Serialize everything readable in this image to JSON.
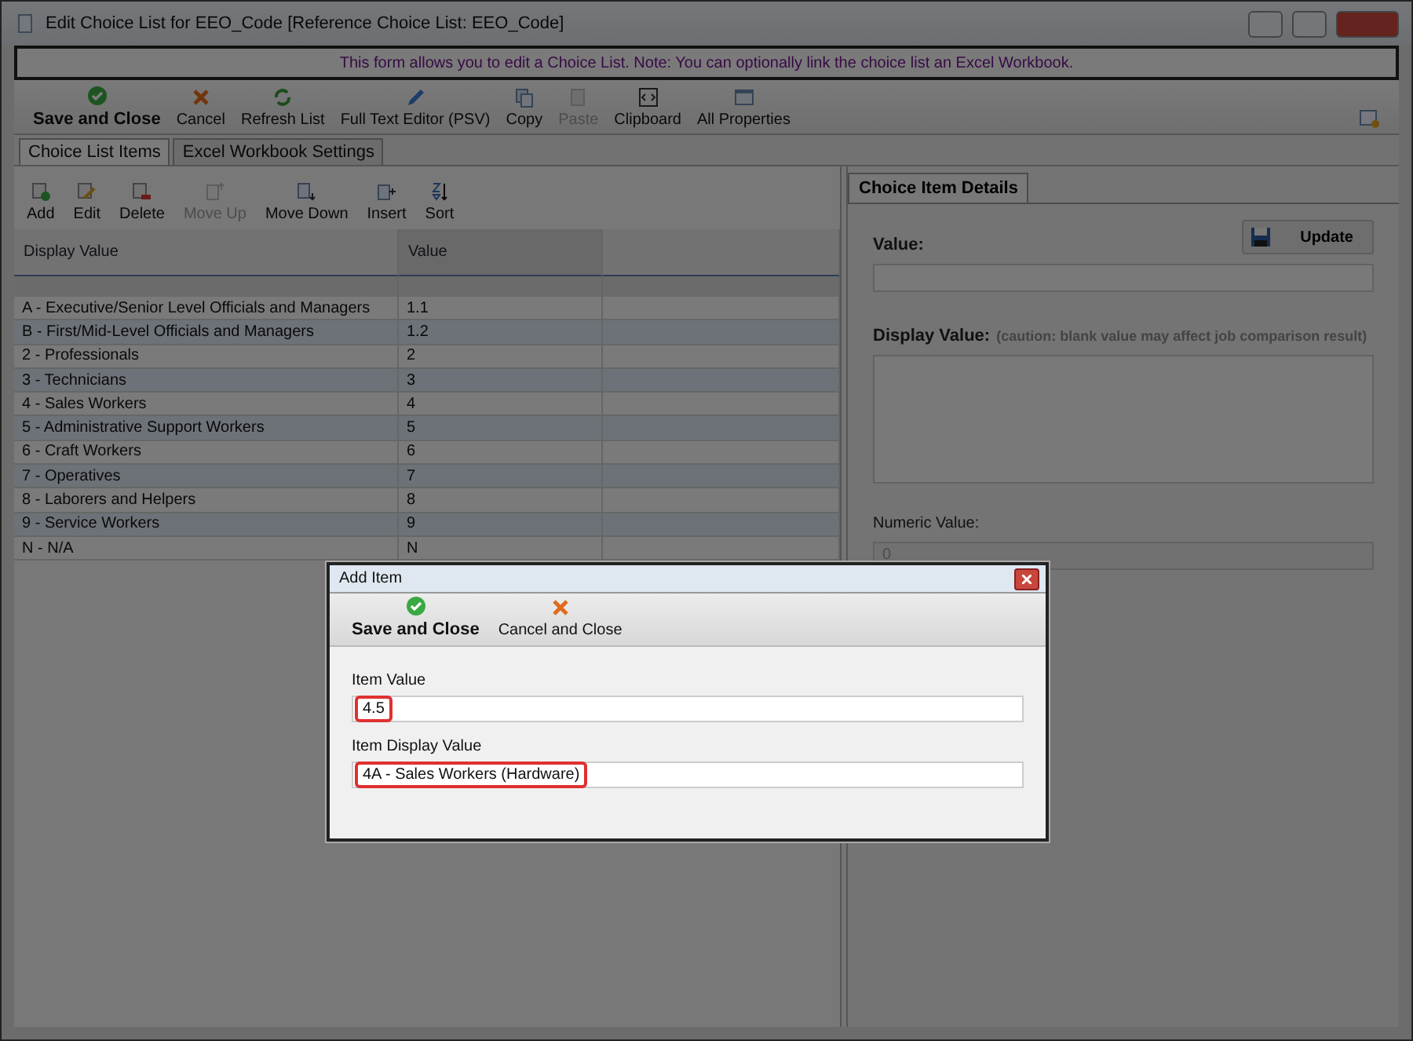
{
  "window": {
    "title": "Edit Choice List for EEO_Code [Reference Choice List: EEO_Code]"
  },
  "banner": "This form allows you to edit a Choice List.  Note: You can optionally link the choice list an Excel Workbook.",
  "toolbar": [
    {
      "label": "Save and Close",
      "primary": true,
      "disabled": false
    },
    {
      "label": "Cancel",
      "primary": false,
      "disabled": false
    },
    {
      "label": "Refresh List",
      "primary": false,
      "disabled": false
    },
    {
      "label": "Full Text Editor (PSV)",
      "primary": false,
      "disabled": false
    },
    {
      "label": "Copy",
      "primary": false,
      "disabled": false
    },
    {
      "label": "Paste",
      "primary": false,
      "disabled": true
    },
    {
      "label": "Clipboard",
      "primary": false,
      "disabled": false
    },
    {
      "label": "All Properties",
      "primary": false,
      "disabled": false
    }
  ],
  "tabs": [
    {
      "label": "Choice List Items",
      "selected": true
    },
    {
      "label": "Excel Workbook Settings",
      "selected": false
    }
  ],
  "list_toolbar": [
    {
      "label": "Add",
      "disabled": false
    },
    {
      "label": "Edit",
      "disabled": false
    },
    {
      "label": "Delete",
      "disabled": false
    },
    {
      "label": "Move Up",
      "disabled": true
    },
    {
      "label": "Move Down",
      "disabled": false
    },
    {
      "label": "Insert",
      "disabled": false
    },
    {
      "label": "Sort",
      "disabled": false
    }
  ],
  "table": {
    "columns": [
      "Display Value",
      "Value"
    ],
    "rows": [
      {
        "display_value": "A - Executive/Senior Level Officials and Managers",
        "value": "1.1"
      },
      {
        "display_value": "B - First/Mid-Level Officials and Managers",
        "value": "1.2"
      },
      {
        "display_value": "2 - Professionals",
        "value": "2"
      },
      {
        "display_value": "3 - Technicians",
        "value": "3"
      },
      {
        "display_value": "4 - Sales Workers",
        "value": "4"
      },
      {
        "display_value": "5 - Administrative Support Workers",
        "value": "5"
      },
      {
        "display_value": "6 - Craft Workers",
        "value": "6"
      },
      {
        "display_value": "7 - Operatives",
        "value": "7"
      },
      {
        "display_value": "8 - Laborers and Helpers",
        "value": "8"
      },
      {
        "display_value": "9 - Service Workers",
        "value": "9"
      },
      {
        "display_value": "N - N/A",
        "value": "N"
      }
    ]
  },
  "details": {
    "tab": "Choice Item Details",
    "value_label": "Value:",
    "update_button": "Update",
    "display_value_label": "Display Value:",
    "display_value_note": "(caution: blank value may affect job comparison result)",
    "numeric_value_label": "Numeric Value:",
    "numeric_value": "0"
  },
  "dialog": {
    "title": "Add Item",
    "toolbar": [
      {
        "label": "Save and Close",
        "primary": true
      },
      {
        "label": "Cancel and Close",
        "primary": false
      }
    ],
    "fields": [
      {
        "label": "Item Value",
        "value": "4.5",
        "highlighted": true
      },
      {
        "label": "Item Display Value",
        "value": "4A - Sales Workers (Hardware)",
        "highlighted": true
      }
    ]
  }
}
